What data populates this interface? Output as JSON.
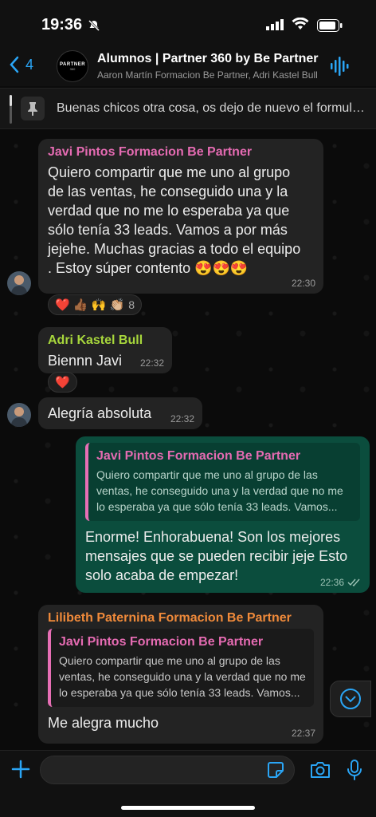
{
  "status": {
    "time": "19:36"
  },
  "header": {
    "back_count": "4",
    "title": "Alumnos | Partner 360 by Be Partner",
    "members": "Aaron Martín Formacion Be Partner, Adri Kastel Bull",
    "avatar_brand": "PARTNER",
    "avatar_sub": "360"
  },
  "pinned": {
    "text": "Buenas chicos otra cosa, os dejo de nuevo el formulario"
  },
  "messages": [
    {
      "sender": "Javi Pintos Formacion Be Partner",
      "sender_color": "#e56bb2",
      "text": "Quiero compartir que me uno al grupo de las ventas, he conseguido una y la verdad que no me lo esperaba ya que sólo tenía 33 leads. Vamos a por más jejehe. Muchas gracias a todo el equipo . Estoy súper contento 😍😍😍",
      "time": "22:30",
      "reactions": "❤️ 👍🏾 🙌 👏🏼",
      "reaction_count": "8"
    },
    {
      "sender": "Adri Kastel Bull",
      "sender_color": "#a7d63c",
      "text": "Biennn Javi",
      "time": "22:32",
      "reactions": "❤️"
    },
    {
      "text": "Alegría absoluta",
      "time": "22:32"
    },
    {
      "outgoing": true,
      "quote_name": "Javi Pintos Formacion Be Partner",
      "quote_text": "Quiero compartir que me uno al grupo de las ventas, he conseguido una y la verdad que no me lo esperaba ya que sólo tenía 33 leads. Vamos...",
      "text": "Enorme! Enhorabuena! Son los mejores mensajes que se pueden recibir jeje Esto solo acaba de empezar!",
      "time": "22:36"
    },
    {
      "sender": "Lilibeth Paternina Formacion Be Partner",
      "sender_color": "#f08a3a",
      "quote_name": "Javi Pintos Formacion Be Partner",
      "quote_text": "Quiero compartir que me uno al grupo de las ventas, he conseguido una y la verdad que no me lo esperaba ya que sólo tenía 33 leads. Vamos...",
      "text": "Me alegra mucho",
      "time": "22:37"
    }
  ],
  "composer": {
    "placeholder": ""
  },
  "colors": {
    "accent": "#2aa5f5",
    "outgoing_bubble": "#0b4d3d",
    "incoming_bubble": "#232323"
  }
}
